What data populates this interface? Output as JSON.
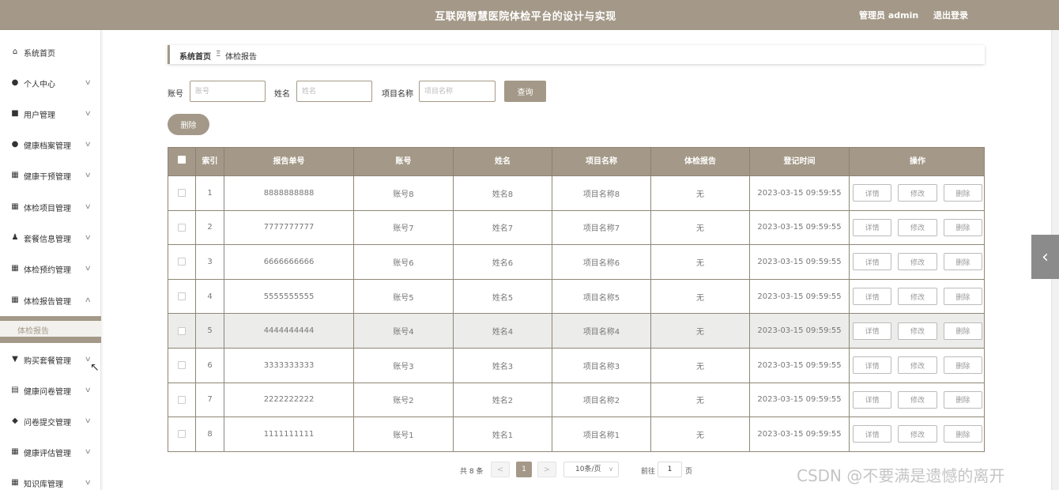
{
  "header": {
    "title": "互联网智慧医院体检平台的设计与实现",
    "user": "管理员 admin",
    "logout": "退出登录"
  },
  "sidebar": {
    "items": [
      {
        "label": "系统首页",
        "icon": "home-icon",
        "arrow": ""
      },
      {
        "label": "个人中心",
        "icon": "user-icon",
        "arrow": "∨"
      },
      {
        "label": "用户管理",
        "icon": "briefcase-icon",
        "arrow": "∨"
      },
      {
        "label": "健康档案管理",
        "icon": "user-icon",
        "arrow": "∨"
      },
      {
        "label": "健康干预管理",
        "icon": "grid-icon",
        "arrow": "∨"
      },
      {
        "label": "体检项目管理",
        "icon": "grid-icon",
        "arrow": "∨"
      },
      {
        "label": "套餐信息管理",
        "icon": "person-icon",
        "arrow": "∨"
      },
      {
        "label": "体检预约管理",
        "icon": "grid-icon",
        "arrow": "∨"
      },
      {
        "label": "体检报告管理",
        "icon": "grid-icon",
        "arrow": "∧"
      },
      {
        "label": "购买套餐管理",
        "icon": "cup-icon",
        "arrow": "∨"
      },
      {
        "label": "健康问卷管理",
        "icon": "doc-icon",
        "arrow": "∨"
      },
      {
        "label": "问卷提交管理",
        "icon": "pin-icon",
        "arrow": "∨"
      },
      {
        "label": "健康评估管理",
        "icon": "grid-icon",
        "arrow": "∨"
      },
      {
        "label": "知识库管理",
        "icon": "grid-icon",
        "arrow": "∨"
      }
    ],
    "active_sub": "体检报告"
  },
  "breadcrumb": {
    "home": "系统首页",
    "sep": "Ξ",
    "current": "体检报告"
  },
  "search": {
    "account_label": "账号",
    "account_placeholder": "账号",
    "name_label": "姓名",
    "name_placeholder": "姓名",
    "project_label": "项目名称",
    "project_placeholder": "项目名称",
    "query_button": "查询",
    "delete_button": "删除"
  },
  "table": {
    "columns": [
      "索引",
      "报告单号",
      "账号",
      "姓名",
      "项目名称",
      "体检报告",
      "登记时间",
      "操作"
    ],
    "actions": [
      "详情",
      "修改",
      "删除"
    ],
    "rows": [
      {
        "index": "1",
        "report_no": "8888888888",
        "account": "账号8",
        "name": "姓名8",
        "project": "项目名称8",
        "report": "无",
        "time": "2023-03-15 09:59:55"
      },
      {
        "index": "2",
        "report_no": "7777777777",
        "account": "账号7",
        "name": "姓名7",
        "project": "项目名称7",
        "report": "无",
        "time": "2023-03-15 09:59:55"
      },
      {
        "index": "3",
        "report_no": "6666666666",
        "account": "账号6",
        "name": "姓名6",
        "project": "项目名称6",
        "report": "无",
        "time": "2023-03-15 09:59:55"
      },
      {
        "index": "4",
        "report_no": "5555555555",
        "account": "账号5",
        "name": "姓名5",
        "project": "项目名称5",
        "report": "无",
        "time": "2023-03-15 09:59:55"
      },
      {
        "index": "5",
        "report_no": "4444444444",
        "account": "账号4",
        "name": "姓名4",
        "project": "项目名称4",
        "report": "无",
        "time": "2023-03-15 09:59:55"
      },
      {
        "index": "6",
        "report_no": "3333333333",
        "account": "账号3",
        "name": "姓名3",
        "project": "项目名称3",
        "report": "无",
        "time": "2023-03-15 09:59:55"
      },
      {
        "index": "7",
        "report_no": "2222222222",
        "account": "账号2",
        "name": "姓名2",
        "project": "项目名称2",
        "report": "无",
        "time": "2023-03-15 09:59:55"
      },
      {
        "index": "8",
        "report_no": "1111111111",
        "account": "账号1",
        "name": "姓名1",
        "project": "项目名称1",
        "report": "无",
        "time": "2023-03-15 09:59:55"
      }
    ],
    "highlighted_row": 5
  },
  "pagination": {
    "total": "共 8 条",
    "prev": "<",
    "current": "1",
    "next": ">",
    "page_size": "10条/页",
    "goto_label": "前往",
    "goto_value": "1",
    "page_label": "页"
  },
  "side_arrow": "‹",
  "watermark": "CSDN @不要满是遗憾的离开",
  "colors": {
    "accent": "#a49988",
    "border": "#8f8677"
  }
}
